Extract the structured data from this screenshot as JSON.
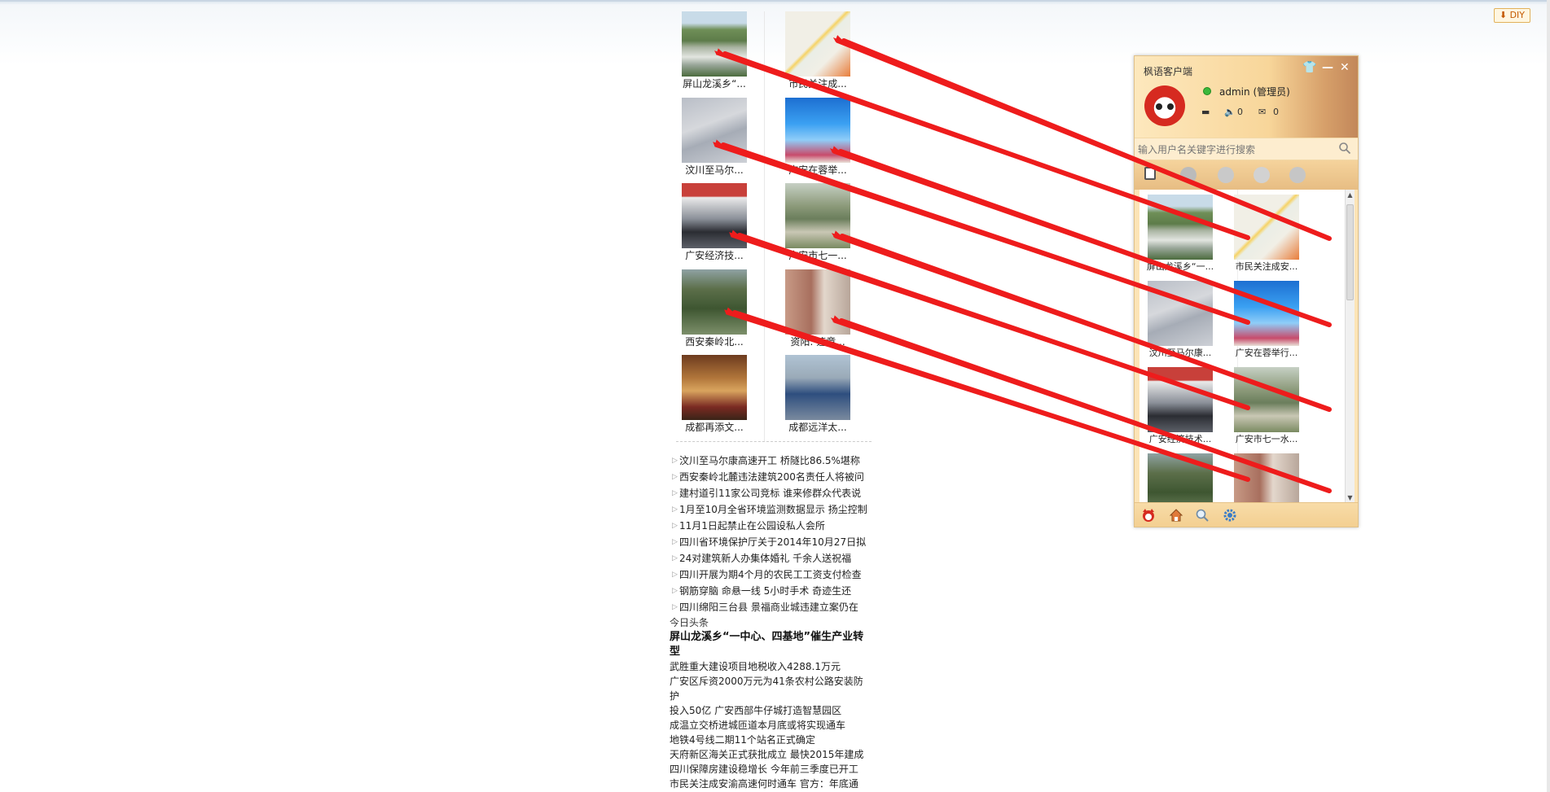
{
  "toolbar": {
    "diy_label": "DIY",
    "diy_icon": "download-arrow-icon"
  },
  "gallery": {
    "items": [
      {
        "caption": "屏山龙溪乡“...",
        "thumb_class": "t1"
      },
      {
        "caption": "市民关注成...",
        "thumb_class": "t2"
      },
      {
        "caption": "汶川至马尔...",
        "thumb_class": "t3"
      },
      {
        "caption": "广安在蓉举...",
        "thumb_class": "t4"
      },
      {
        "caption": "广安经济技...",
        "thumb_class": "t5"
      },
      {
        "caption": "广安市七一...",
        "thumb_class": "t6"
      },
      {
        "caption": "西安秦岭北...",
        "thumb_class": "t7"
      },
      {
        "caption": "资阳: 违章...",
        "thumb_class": "t8"
      },
      {
        "caption": "成都再添文...",
        "thumb_class": "t9"
      },
      {
        "caption": "成都远洋太...",
        "thumb_class": "t10"
      }
    ]
  },
  "news_list": [
    "汶川至马尔康高速开工 桥隧比86.5%堪称",
    "西安秦岭北麓违法建筑200名责任人将被问",
    "建村道引11家公司竞标 谁来修群众代表说",
    "1月至10月全省环境监测数据显示 扬尘控制",
    "11月1日起禁止在公园设私人会所",
    "四川省环境保护厅关于2014年10月27日拟",
    "24对建筑新人办集体婚礼 千余人送祝福",
    "四川开展为期4个月的农民工工资支付检查",
    "钢筋穿脑 命悬一线 5小时手术 奇迹生还",
    "四川绵阳三台县 景福商业城违建立案仍在"
  ],
  "today": {
    "label": "今日头条",
    "headline": "屏山龙溪乡“一中心、四基地”催生产业转型",
    "items": [
      "武胜重大建设项目地税收入4288.1万元",
      "广安区斥资2000万元为41条农村公路安装防护",
      "投入50亿 广安西部牛仔城打造智慧园区",
      "成温立交桥进城匝道本月底或将实现通车",
      "地铁4号线二期11个站名正式确定",
      "天府新区海关正式获批成立 最快2015年建成",
      "四川保障房建设稳增长 今年前三季度已开工",
      "市民关注成安渝高速何时通车 官方：年底通"
    ]
  },
  "client": {
    "title": "枫语客户端",
    "username": "admin",
    "role": "(管理员)",
    "volume_count": "0",
    "mail_count": "0",
    "search_placeholder": "输入用户名关键字进行搜索",
    "items": [
      {
        "caption": "屏山龙溪乡“一...",
        "thumb_class": "t1"
      },
      {
        "caption": "市民关注成安...",
        "thumb_class": "t2"
      },
      {
        "caption": "汶川至马尔康...",
        "thumb_class": "t3"
      },
      {
        "caption": "广安在蓉举行...",
        "thumb_class": "t4"
      },
      {
        "caption": "广安经济技术...",
        "thumb_class": "t5"
      },
      {
        "caption": "广安市七一水...",
        "thumb_class": "t6"
      },
      {
        "caption": "",
        "thumb_class": "t7"
      },
      {
        "caption": "",
        "thumb_class": "t8"
      }
    ]
  },
  "colors": {
    "arrow": "#ee1c1c",
    "panel_bg": "#fce4b6",
    "accent": "#d62a20"
  }
}
